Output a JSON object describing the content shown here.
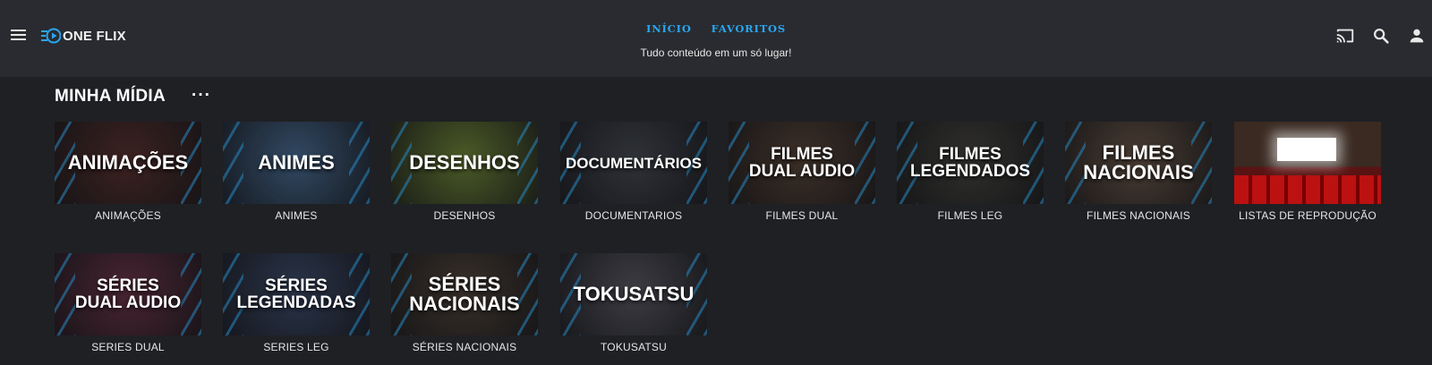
{
  "header": {
    "brand": "ONE FLIX",
    "nav": [
      {
        "label": "INÍCIO"
      },
      {
        "label": "FAVORITOS"
      }
    ],
    "tagline": "Tudo conteúdo em um só lugar!",
    "icons": [
      "menu-icon",
      "cast-icon",
      "search-icon",
      "user-icon"
    ]
  },
  "section": {
    "title": "MINHA MÍDIA",
    "more": "···"
  },
  "tiles": [
    {
      "label": "ANIMAÇÕES",
      "thumb_text": "ANIMAÇÕES",
      "bg": "#4a2a28"
    },
    {
      "label": "ANIMES",
      "thumb_text": "ANIMES",
      "bg": "#3d5a7a"
    },
    {
      "label": "DESENHOS",
      "thumb_text": "DESENHOS",
      "bg": "#5d6f30"
    },
    {
      "label": "DOCUMENTARIOS",
      "thumb_text": "DOCUMENTÁRIOS",
      "bg": "#3a3d44"
    },
    {
      "label": "FILMES DUAL",
      "thumb_text": "FILMES\nDUAL AUDIO",
      "bg": "#4a3a30"
    },
    {
      "label": "FILMES LEG",
      "thumb_text": "FILMES\nLEGENDADOS",
      "bg": "#3b3a36"
    },
    {
      "label": "FILMES NACIONAIS",
      "thumb_text": "FILMES\nNACIONAIS",
      "bg": "#5a4a3e"
    },
    {
      "label": "LISTAS DE REPRODUÇÃO",
      "thumb_text": "",
      "bg": "#3a2a22"
    },
    {
      "label": "SERIES DUAL",
      "thumb_text": "SÉRIES\nDUAL AUDIO",
      "bg": "#5a2d3e"
    },
    {
      "label": "SERIES LEG",
      "thumb_text": "SÉRIES\nLEGENDADAS",
      "bg": "#34405a"
    },
    {
      "label": "SÉRIES NACIONAIS",
      "thumb_text": "SÉRIES\nNACIONAIS",
      "bg": "#443a32"
    },
    {
      "label": "TOKUSATSU",
      "thumb_text": "TOKUSATSU",
      "bg": "#4a4a52"
    }
  ],
  "colors": {
    "accent": "#28a7f0",
    "header_bg": "#2a2b30",
    "page_bg": "#1f2024"
  }
}
